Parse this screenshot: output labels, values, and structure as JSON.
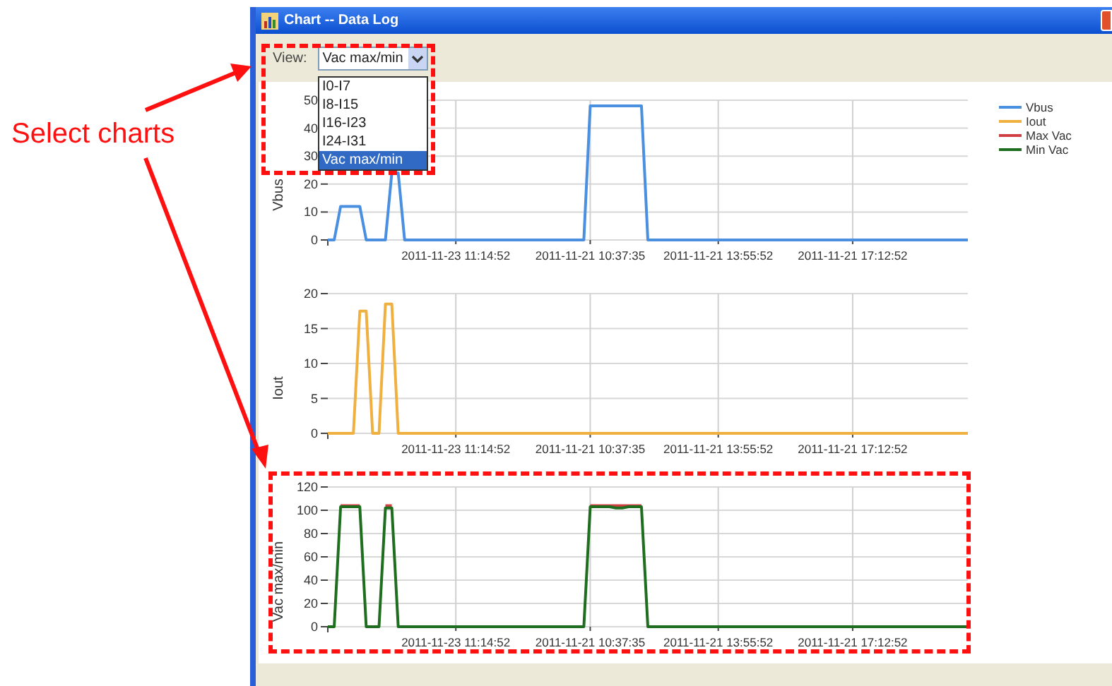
{
  "annotation": {
    "text": "Select charts"
  },
  "window": {
    "title": "Chart -- Data Log"
  },
  "view": {
    "label": "View:",
    "value": "Vac max/min",
    "options": [
      {
        "label": "I0-I7",
        "selected": false
      },
      {
        "label": "I8-I15",
        "selected": false
      },
      {
        "label": "I16-I23",
        "selected": false
      },
      {
        "label": "I24-I31",
        "selected": false
      },
      {
        "label": "Vac max/min",
        "selected": true
      }
    ]
  },
  "charts": [
    {
      "chart_data": {
        "type": "line",
        "grid": true,
        "ylabel": "Vbus",
        "ylim": [
          0,
          50
        ],
        "yticks": [
          0,
          10,
          20,
          30,
          40,
          50
        ],
        "categories": [
          null,
          null,
          null,
          null,
          null,
          null,
          null,
          null,
          null,
          null,
          null,
          null,
          null,
          null,
          null,
          null,
          null,
          null,
          null,
          null,
          "2011-11-23 11:14:52",
          null,
          null,
          null,
          null,
          null,
          null,
          null,
          null,
          null,
          null,
          null,
          null,
          null,
          null,
          null,
          null,
          null,
          null,
          null,
          null,
          "2011-11-21 10:37:35",
          null,
          null,
          null,
          null,
          null,
          null,
          null,
          null,
          null,
          null,
          null,
          null,
          null,
          null,
          null,
          null,
          null,
          null,
          null,
          "2011-11-21 13:55:52",
          null,
          null,
          null,
          null,
          null,
          null,
          null,
          null,
          null,
          null,
          null,
          null,
          null,
          null,
          null,
          null,
          null,
          null,
          null,
          null,
          "2011-11-21 17:12:52",
          null,
          null,
          null,
          null,
          null,
          null,
          null,
          null,
          null,
          null,
          null,
          null,
          null,
          null,
          null,
          null,
          null,
          null
        ],
        "series": [
          {
            "name": "Vbus",
            "color": "#4a8fe0",
            "values": [
              0,
              0,
              12,
              12,
              12,
              12,
              0,
              0,
              0,
              0,
              24,
              24,
              0,
              0,
              0,
              0,
              0,
              0,
              0,
              0,
              0,
              0,
              0,
              0,
              0,
              0,
              0,
              0,
              0,
              0,
              0,
              0,
              0,
              0,
              0,
              0,
              0,
              0,
              0,
              0,
              0,
              48,
              48,
              48,
              48,
              48,
              48,
              48,
              48,
              48,
              0,
              0,
              0,
              0,
              0,
              0,
              0,
              0,
              0,
              0,
              0,
              0,
              0,
              0,
              0,
              0,
              0,
              0,
              0,
              0,
              0,
              0,
              0,
              0,
              0,
              0,
              0,
              0,
              0,
              0,
              0,
              0,
              0,
              0,
              0,
              0,
              0,
              0,
              0,
              0,
              0,
              0,
              0,
              0,
              0,
              0,
              0,
              0,
              0,
              0,
              0
            ]
          }
        ]
      }
    },
    {
      "chart_data": {
        "type": "line",
        "grid": true,
        "ylabel": "Iout",
        "ylim": [
          0,
          20
        ],
        "yticks": [
          0,
          5,
          10,
          15,
          20
        ],
        "categories": [
          null,
          null,
          null,
          null,
          null,
          null,
          null,
          null,
          null,
          null,
          null,
          null,
          null,
          null,
          null,
          null,
          null,
          null,
          null,
          null,
          "2011-11-23 11:14:52",
          null,
          null,
          null,
          null,
          null,
          null,
          null,
          null,
          null,
          null,
          null,
          null,
          null,
          null,
          null,
          null,
          null,
          null,
          null,
          null,
          "2011-11-21 10:37:35",
          null,
          null,
          null,
          null,
          null,
          null,
          null,
          null,
          null,
          null,
          null,
          null,
          null,
          null,
          null,
          null,
          null,
          null,
          null,
          "2011-11-21 13:55:52",
          null,
          null,
          null,
          null,
          null,
          null,
          null,
          null,
          null,
          null,
          null,
          null,
          null,
          null,
          null,
          null,
          null,
          null,
          null,
          null,
          "2011-11-21 17:12:52",
          null,
          null,
          null,
          null,
          null,
          null,
          null,
          null,
          null,
          null,
          null,
          null,
          null,
          null,
          null,
          null,
          null,
          null
        ],
        "series": [
          {
            "name": "Iout",
            "color": "#f0b040",
            "values": [
              0,
              0,
              0,
              0,
              0,
              17.5,
              17.5,
              0,
              0,
              18.5,
              18.5,
              0,
              0,
              0,
              0,
              0,
              0,
              0,
              0,
              0,
              0,
              0,
              0,
              0,
              0,
              0,
              0,
              0,
              0,
              0,
              0,
              0,
              0,
              0,
              0,
              0,
              0,
              0,
              0,
              0,
              0,
              0,
              0,
              0,
              0,
              0,
              0,
              0,
              0,
              0,
              0,
              0,
              0,
              0,
              0,
              0,
              0,
              0,
              0,
              0,
              0,
              0,
              0,
              0,
              0,
              0,
              0,
              0,
              0,
              0,
              0,
              0,
              0,
              0,
              0,
              0,
              0,
              0,
              0,
              0,
              0,
              0,
              0,
              0,
              0,
              0,
              0,
              0,
              0,
              0,
              0,
              0,
              0,
              0,
              0,
              0,
              0,
              0,
              0,
              0,
              0
            ]
          }
        ]
      }
    },
    {
      "chart_data": {
        "type": "line",
        "grid": true,
        "ylabel": "Vac max/min",
        "ylim": [
          0,
          120
        ],
        "yticks": [
          0,
          20,
          40,
          60,
          80,
          100,
          120
        ],
        "categories": [
          null,
          null,
          null,
          null,
          null,
          null,
          null,
          null,
          null,
          null,
          null,
          null,
          null,
          null,
          null,
          null,
          null,
          null,
          null,
          null,
          "2011-11-23 11:14:52",
          null,
          null,
          null,
          null,
          null,
          null,
          null,
          null,
          null,
          null,
          null,
          null,
          null,
          null,
          null,
          null,
          null,
          null,
          null,
          null,
          "2011-11-21 10:37:35",
          null,
          null,
          null,
          null,
          null,
          null,
          null,
          null,
          null,
          null,
          null,
          null,
          null,
          null,
          null,
          null,
          null,
          null,
          null,
          "2011-11-21 13:55:52",
          null,
          null,
          null,
          null,
          null,
          null,
          null,
          null,
          null,
          null,
          null,
          null,
          null,
          null,
          null,
          null,
          null,
          null,
          null,
          null,
          "2011-11-21 17:12:52",
          null,
          null,
          null,
          null,
          null,
          null,
          null,
          null,
          null,
          null,
          null,
          null,
          null,
          null,
          null,
          null,
          null,
          null
        ],
        "series": [
          {
            "name": "Max Vac",
            "color": "#d04040",
            "values": [
              null,
              null,
              104,
              104,
              104,
              104,
              null,
              null,
              null,
              104,
              104,
              null,
              null,
              null,
              null,
              null,
              null,
              null,
              null,
              null,
              null,
              null,
              null,
              null,
              null,
              null,
              null,
              null,
              null,
              null,
              null,
              null,
              null,
              null,
              null,
              null,
              null,
              null,
              null,
              null,
              null,
              104,
              104,
              104,
              104,
              104,
              104,
              104,
              104,
              104,
              null,
              null,
              null,
              null,
              null,
              null,
              null,
              null,
              null,
              null,
              null,
              null,
              null,
              null,
              null,
              null,
              null,
              null,
              null,
              null,
              null,
              null,
              null,
              null,
              null,
              null,
              null,
              null,
              null,
              null,
              null,
              null,
              null,
              null,
              null,
              null,
              null,
              null,
              null,
              null,
              null,
              null,
              null,
              null,
              null,
              null,
              null,
              null,
              null,
              null,
              null
            ]
          },
          {
            "name": "Min Vac",
            "color": "#1f6e1f",
            "values": [
              0,
              0,
              103,
              103,
              103,
              103,
              0,
              0,
              0,
              102,
              102,
              0,
              0,
              0,
              0,
              0,
              0,
              0,
              0,
              0,
              0,
              0,
              0,
              0,
              0,
              0,
              0,
              0,
              0,
              0,
              0,
              0,
              0,
              0,
              0,
              0,
              0,
              0,
              0,
              0,
              0,
              103,
              103,
              103,
              103,
              102,
              102,
              103,
              103,
              103,
              0,
              0,
              0,
              0,
              0,
              0,
              0,
              0,
              0,
              0,
              0,
              0,
              0,
              0,
              0,
              0,
              0,
              0,
              0,
              0,
              0,
              0,
              0,
              0,
              0,
              0,
              0,
              0,
              0,
              0,
              0,
              0,
              0,
              0,
              0,
              0,
              0,
              0,
              0,
              0,
              0,
              0,
              0,
              0,
              0,
              0,
              0,
              0,
              0,
              0,
              0
            ]
          }
        ]
      }
    }
  ]
}
